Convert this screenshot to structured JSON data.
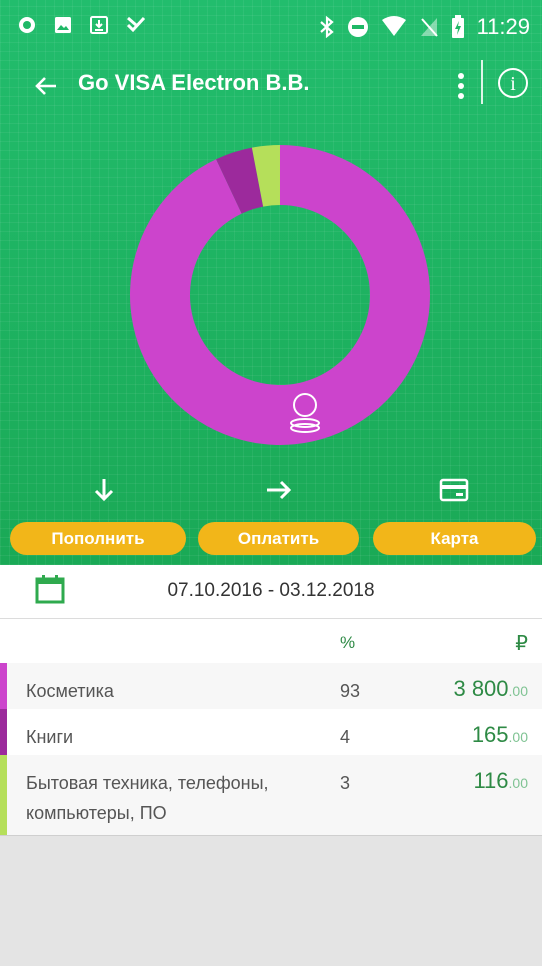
{
  "status_bar": {
    "time": "11:29",
    "left_icons": [
      "app-notification-icon",
      "image-icon",
      "download-icon",
      "verified-icon"
    ],
    "right_icons": [
      "bluetooth-icon",
      "do-not-disturb-icon",
      "wifi-icon",
      "no-sim-icon",
      "battery-charging-icon"
    ]
  },
  "app_bar": {
    "title": "Go VISA Electron B.B."
  },
  "chart_data": {
    "type": "pie",
    "donut": true,
    "categories": [
      "Косметика",
      "Книги",
      "Бытовая техника, телефоны, компьютеры, ПО"
    ],
    "values": [
      93,
      4,
      3
    ],
    "colors": [
      "#cc44cc",
      "#9c2a9c",
      "#b5df5a"
    ],
    "center_icon": "coins-icon"
  },
  "actions": [
    {
      "label": "Пополнить",
      "icon": "arrow-down-icon"
    },
    {
      "label": "Оплатить",
      "icon": "arrow-right-icon"
    },
    {
      "label": "Карта",
      "icon": "credit-card-icon"
    }
  ],
  "period": {
    "icon": "calendar-icon",
    "range": "07.10.2016 - 03.12.2018"
  },
  "table": {
    "header_percent": "%",
    "header_currency": "₽",
    "rows": [
      {
        "name": "Косметика",
        "percent": "93",
        "amount_int": "3 800",
        "amount_dec": ".00",
        "color": "#cc44cc"
      },
      {
        "name": "Книги",
        "percent": "4",
        "amount_int": "165",
        "amount_dec": ".00",
        "color": "#9c2a9c"
      },
      {
        "name": "Бытовая техника, телефоны, компьютеры, ПО",
        "percent": "3",
        "amount_int": "116",
        "amount_dec": ".00",
        "color": "#b5df5a"
      }
    ]
  }
}
